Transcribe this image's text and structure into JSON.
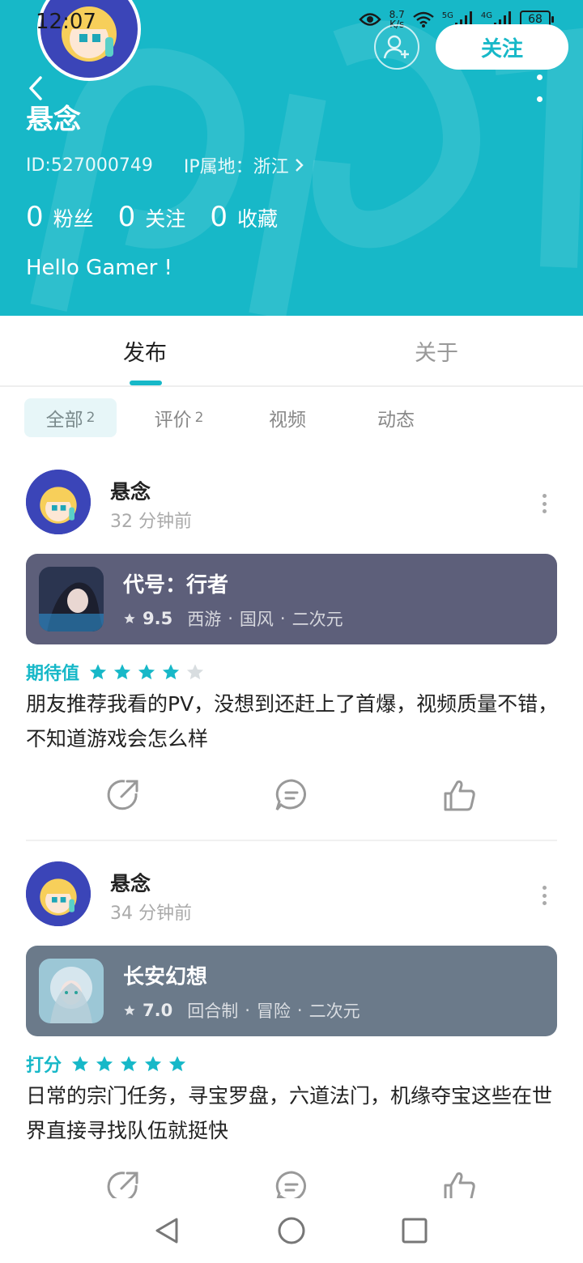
{
  "status_bar": {
    "time": "12:07",
    "speed_value": "8.7",
    "speed_unit": "K/s",
    "net1": "5G",
    "net2": "4G",
    "battery": "68"
  },
  "profile": {
    "follow_button": "关注",
    "name": "悬念",
    "id_text": "ID:527000749",
    "ip_text": "IP属地：浙江",
    "stats": [
      {
        "num": "0",
        "label": "粉丝"
      },
      {
        "num": "0",
        "label": "关注"
      },
      {
        "num": "0",
        "label": "收藏"
      }
    ],
    "bio": "Hello Gamer !"
  },
  "tabs": [
    {
      "label": "发布",
      "active": true
    },
    {
      "label": "关于",
      "active": false
    }
  ],
  "filters": [
    {
      "label": "全部",
      "count": "2",
      "active": true
    },
    {
      "label": "评价",
      "count": "2",
      "active": false
    },
    {
      "label": "视频",
      "count": "",
      "active": false
    },
    {
      "label": "动态",
      "count": "",
      "active": false
    }
  ],
  "posts": [
    {
      "author": "悬念",
      "time": "32 分钟前",
      "game": {
        "title": "代号：行者",
        "score": "9.5",
        "tags": [
          "西游",
          "国风",
          "二次元"
        ],
        "card_color": "#5d5f7a"
      },
      "rating_label": "期待值",
      "stars": 4,
      "text": "朋友推荐我看的PV，没想到还赶上了首爆，视频质量不错，不知道游戏会怎么样"
    },
    {
      "author": "悬念",
      "time": "34 分钟前",
      "game": {
        "title": "长安幻想",
        "score": "7.0",
        "tags": [
          "回合制",
          "冒险",
          "二次元"
        ],
        "card_color": "#6b7a8a"
      },
      "rating_label": "打分",
      "stars": 5,
      "text": "日常的宗门任务，寻宝罗盘，六道法门，机缘夺宝这些在世界直接寻找队伍就挺快"
    }
  ],
  "colors": {
    "accent": "#17b8c8",
    "star_off": "#d8dde0"
  }
}
